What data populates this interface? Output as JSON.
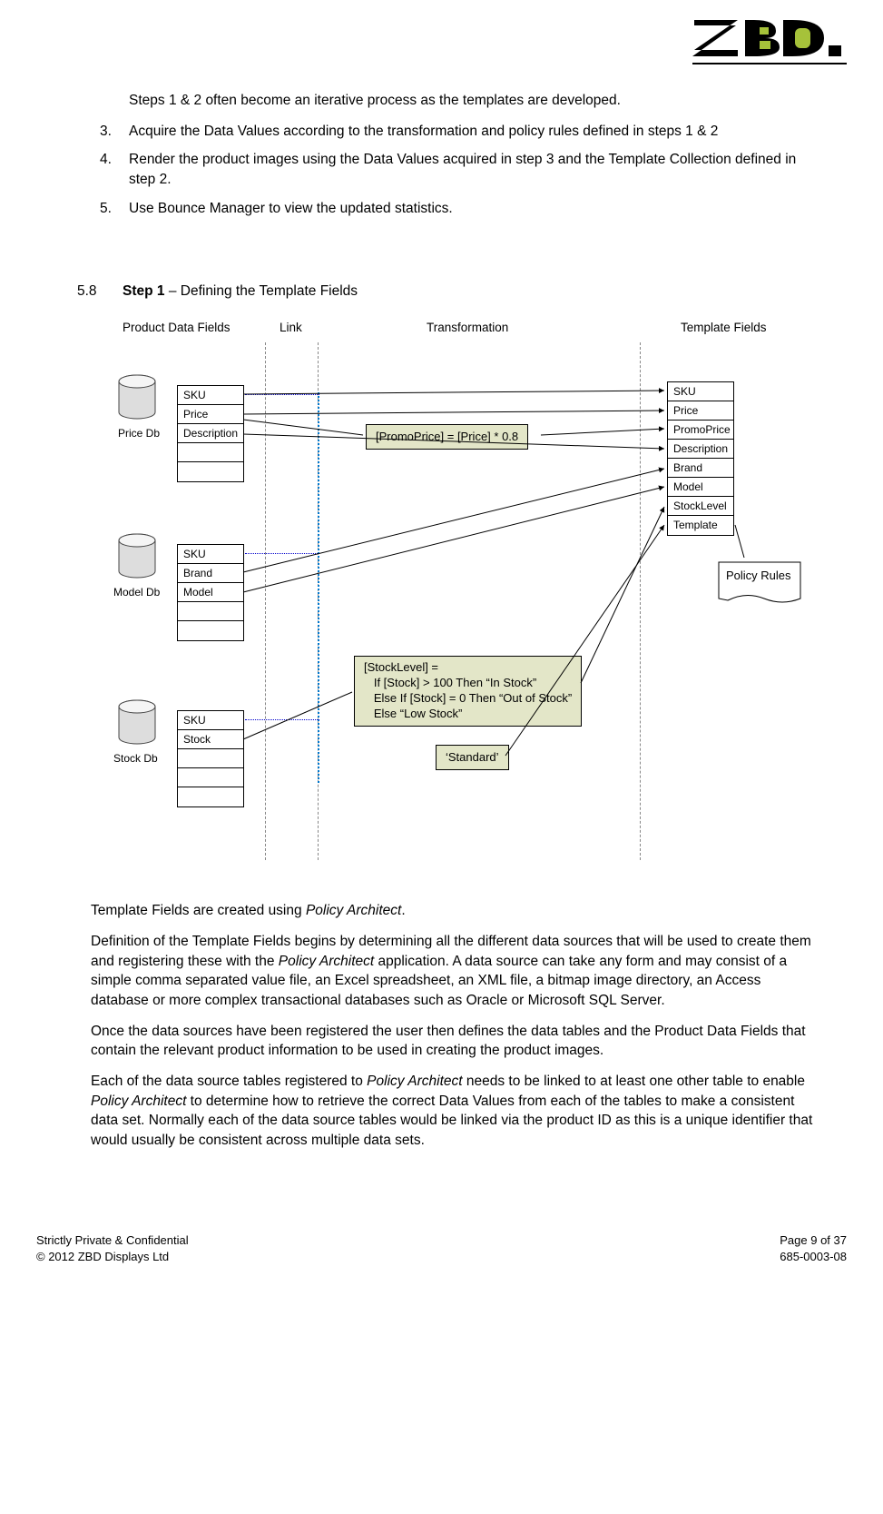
{
  "intro_note": "Steps 1 & 2 often become an iterative process as the templates are developed.",
  "list": {
    "item3_num": "3.",
    "item3": "Acquire the Data Values according to the transformation and policy rules defined in steps 1 & 2",
    "item4_num": "4.",
    "item4": "Render the product images using the Data Values acquired in step 3 and the Template Collection defined in step 2.",
    "item5_num": "5.",
    "item5": "Use Bounce Manager to view the updated statistics."
  },
  "section": {
    "num": "5.8",
    "title_bold": "Step 1",
    "title_rest": " – Defining the Template Fields"
  },
  "diagram": {
    "headers": {
      "pdf": "Product Data Fields",
      "link": "Link",
      "trans": "Transformation",
      "tf": "Template Fields"
    },
    "dblabels": {
      "price": "Price Db",
      "model": "Model Db",
      "stock": "Stock Db"
    },
    "price_fields": {
      "r1": "SKU",
      "r2": "Price",
      "r3": "Description",
      "r4": "",
      "r5": ""
    },
    "model_fields": {
      "r1": "SKU",
      "r2": "Brand",
      "r3": "Model",
      "r4": "",
      "r5": ""
    },
    "stock_fields": {
      "r1": "SKU",
      "r2": "Stock",
      "r3": "",
      "r4": "",
      "r5": ""
    },
    "template_fields": {
      "r1": "SKU",
      "r2": "Price",
      "r3": "PromoPrice",
      "r4": "Description",
      "r5": "Brand",
      "r6": "Model",
      "r7": "StockLevel",
      "r8": "Template"
    },
    "trans1": "[PromoPrice] = [Price] * 0.8",
    "trans2_l1": "[StockLevel] =",
    "trans2_l2": "   If [Stock] > 100 Then “In Stock”",
    "trans2_l3": "   Else If [Stock] = 0 Then “Out of Stock”",
    "trans2_l4": "   Else “Low Stock”",
    "standard": "‘Standard’",
    "policy": "Policy Rules"
  },
  "body": {
    "p1_a": "Template Fields are created using ",
    "p1_i": "Policy Architect",
    "p1_c": ".",
    "p2_a": "Definition of the Template Fields begins by determining all the different data sources that will be used to create them and registering these with the ",
    "p2_i": "Policy Architect",
    "p2_c": " application. A data source can take any form and may consist of a simple comma separated value file, an Excel spreadsheet, an XML file, a bitmap image directory, an Access database or more complex transactional databases such as Oracle or Microsoft SQL Server.",
    "p3": "Once the data sources have been registered the user then defines the data tables and the Product Data Fields that contain the relevant product information to be used in creating the product images.",
    "p4_a": "Each of the data source tables registered to ",
    "p4_i1": "Policy Architect",
    "p4_b": " needs to be linked to at least one other table to enable ",
    "p4_i2": "Policy Architect",
    "p4_c": " to determine how to retrieve the correct Data Values from each of the tables to make a consistent data set. Normally each of the data source tables would be linked via the product ID as this is a unique identifier that would usually be consistent across multiple data sets."
  },
  "footer": {
    "l1": "Strictly Private & Confidential",
    "l2": "© 2012 ZBD Displays Ltd",
    "r1": "Page 9 of 37",
    "r2": "685-0003-08"
  }
}
